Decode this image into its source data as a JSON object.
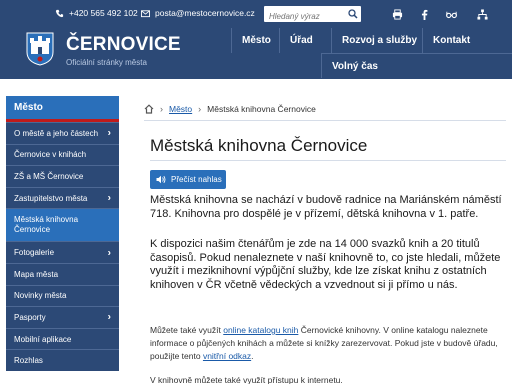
{
  "colors": {
    "header_bg": "#2c4976",
    "accent": "#2a6fba",
    "red_line": "#c01b1b"
  },
  "topbar": {
    "phone": "+420 565 492 102",
    "email": "posta@mestocernovice.cz",
    "search_placeholder": "Hledaný výraz",
    "icons": [
      "phone-icon",
      "mail-icon",
      "search-icon",
      "print-icon",
      "facebook-icon",
      "glasses-icon",
      "sitemap-icon"
    ]
  },
  "brand": {
    "title": "ČERNOVICE",
    "subtitle": "Oficiální stránky města"
  },
  "nav": {
    "mesto": "Město",
    "urad": "Úřad",
    "rozvoj": "Rozvoj a služby",
    "kontakt": "Kontakt",
    "volny_cas": "Volný čas"
  },
  "sidebar": {
    "heading": "Město",
    "items": [
      {
        "label": "O městě a jeho částech",
        "chevron": "›"
      },
      {
        "label": "Černovice v knihách"
      },
      {
        "label": "ZŠ a MŠ Černovice"
      },
      {
        "label": "Zastupitelstvo města",
        "chevron": "›"
      },
      {
        "label_line1": "Městská knihovna",
        "label_line2": "Černovice"
      },
      {
        "label": "Fotogalerie",
        "chevron": "›"
      },
      {
        "label": "Mapa města"
      },
      {
        "label": "Novinky města"
      },
      {
        "label": "Pasporty",
        "chevron": "›"
      },
      {
        "label": "Mobilní aplikace"
      },
      {
        "label": "Rozhlas"
      }
    ]
  },
  "breadcrumb": {
    "home_icon": "home-icon",
    "sep": "›",
    "level1": "Město",
    "current": "Městská knihovna Černovice"
  },
  "page": {
    "title": "Městská knihovna Černovice",
    "read_button": "Přečíst nahlas",
    "p1": "Městská knihovna se nachází v budově radnice na Mariánském náměstí 718. Knihovna pro dospělé je v přízemí, dětská knihovna v 1. patře.",
    "p2": "K dispozici  našim čtenářům je zde na 14 000 svazků knih a 20 titulů časopisů. Pokud nenaleznete v naší knihovně to, co jste hledali, můžete využít i meziknihovní výpůjční služby, kde lze získat knihu z ostatních knihoven v ČR včetně vědeckých a vzvednout si ji přímo u nás.",
    "p3_before": "Můžete také využít ",
    "p3_link": "online katalogu knih",
    "p3_after": " Černovické knihovny. V online katalogu naleznete informace o půjčených knihách a můžete si knížky zarezervovat. Pokud jste v budově úřadu, použijte tento ",
    "p3_link2": "vnitřní odkaz",
    "p3_end": ".",
    "p4": "V knihovně můžete také využít přístupu k internetu."
  }
}
